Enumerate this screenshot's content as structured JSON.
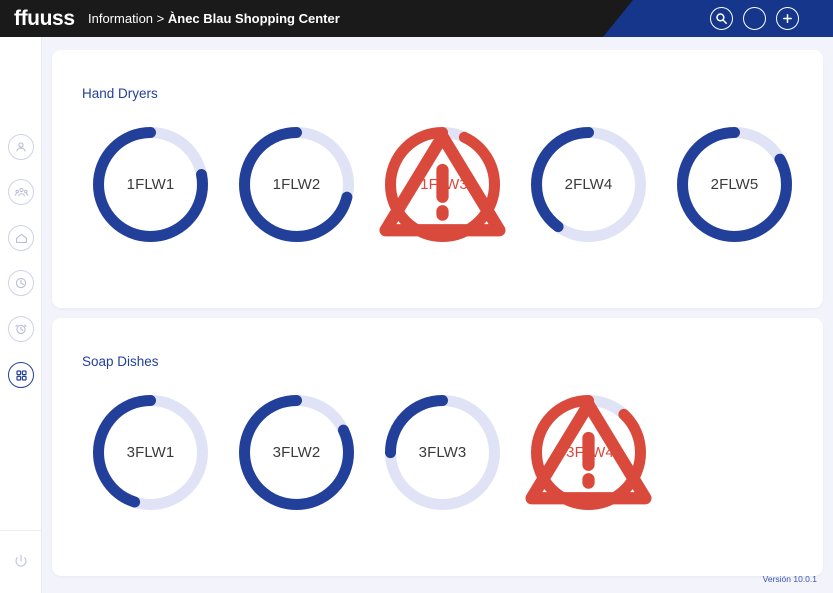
{
  "header": {
    "logo": "ffuuss",
    "breadcrumb_prefix": "Information > ",
    "breadcrumb_current": "Ànec Blau Shopping Center",
    "icons": [
      {
        "name": "search-icon",
        "label": "Search"
      },
      {
        "name": "profile-circle-icon",
        "label": "Profile"
      },
      {
        "name": "add-icon",
        "label": "Add"
      }
    ],
    "accent_color": "#16368c",
    "bar_color": "#1a1a1a"
  },
  "sidebar": {
    "items": [
      {
        "name": "sidebar-item-user",
        "icon": "user-icon",
        "label": "User",
        "active": false
      },
      {
        "name": "sidebar-item-groups",
        "icon": "people-group-icon",
        "label": "Groups",
        "active": false
      },
      {
        "name": "sidebar-item-home",
        "icon": "home-icon",
        "label": "Home",
        "active": false
      },
      {
        "name": "sidebar-item-history",
        "icon": "clock-icon",
        "label": "History",
        "active": false
      },
      {
        "name": "sidebar-item-alarms",
        "icon": "alarm-clock-icon",
        "label": "Alarms",
        "active": false
      },
      {
        "name": "sidebar-item-devices",
        "icon": "grid-apps-icon",
        "label": "Devices",
        "active": true
      }
    ],
    "power": {
      "name": "power-icon",
      "label": "Log out"
    },
    "active_color": "#24409a",
    "inactive_color": "#b9bed8"
  },
  "sections": [
    {
      "title": "Hand Dryers",
      "devices": [
        {
          "id": "1FLW1",
          "percent": 78,
          "status": "ok",
          "alert": false
        },
        {
          "id": "1FLW2",
          "percent": 71,
          "status": "ok",
          "alert": false
        },
        {
          "id": "1FLW3",
          "percent": 93,
          "status": "alert",
          "alert": true
        },
        {
          "id": "2FLW4",
          "percent": 40,
          "status": "ok",
          "alert": false
        },
        {
          "id": "2FLW5",
          "percent": 83,
          "status": "ok",
          "alert": false
        }
      ]
    },
    {
      "title": "Soap Dishes",
      "devices": [
        {
          "id": "3FLW1",
          "percent": 45,
          "status": "ok",
          "alert": false
        },
        {
          "id": "3FLW2",
          "percent": 82,
          "status": "ok",
          "alert": false
        },
        {
          "id": "3FLW3",
          "percent": 25,
          "status": "ok",
          "alert": false
        },
        {
          "id": "3FLW4",
          "percent": 88,
          "status": "alert",
          "alert": true
        }
      ]
    }
  ],
  "colors": {
    "ok_arc": "#22409a",
    "alert_arc": "#da4a3c",
    "track": "#dfe3f5",
    "page_bg": "#f2f3fb",
    "card_bg": "#ffffff",
    "title": "#24409a",
    "label": "#3b3b3b"
  },
  "footer": {
    "version": "Versión 10.0.1"
  }
}
